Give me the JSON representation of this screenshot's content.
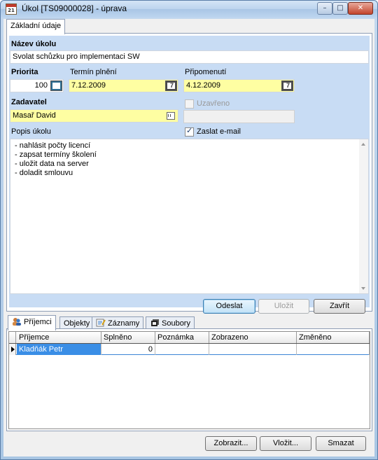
{
  "window": {
    "title": "Úkol [TS09000028] - úprava",
    "icon": "calendar-icon",
    "icon_text": "21"
  },
  "tabs_top": [
    {
      "label": "Základní údaje"
    }
  ],
  "form": {
    "nazev_label": "Název úkolu",
    "nazev_value": "Svolat schůzku pro implementaci SW",
    "priorita_label": "Priorita",
    "priorita_value": "100",
    "termin_label": "Termín plnění",
    "termin_value": "7.12.2009",
    "pripomenuti_label": "Připomenutí",
    "pripomenuti_value": "4.12.2009",
    "zadavatel_label": "Zadavatel",
    "zadavatel_value": "Masař David",
    "uzavreno_label": "Uzavřeno",
    "uzavreno_checked": false,
    "zaslat_label": "Zaslat e-mail",
    "zaslat_checked": true,
    "popis_label": "Popis úkolu",
    "popis_lines": [
      "- nahlásit počty licencí",
      "- zapsat termíny školení",
      "- uložit data na server",
      "- doladit smlouvu"
    ]
  },
  "actions_top": {
    "odeslat": "Odeslat",
    "ulozit": "Uložit",
    "zavrit": "Zavřít"
  },
  "tabs_bottom": [
    {
      "label": "Příjemci",
      "icon": "users-icon"
    },
    {
      "label": "Objekty",
      "icon": ""
    },
    {
      "label": "Záznamy",
      "icon": "notes-icon"
    },
    {
      "label": "Soubory",
      "icon": "files-icon"
    }
  ],
  "grid": {
    "columns": [
      "Příjemce",
      "Splněno",
      "Poznámka",
      "Zobrazeno",
      "Změněno"
    ],
    "rows": [
      [
        "Kladňák Petr",
        "0",
        "",
        "",
        ""
      ]
    ]
  },
  "actions_bottom": {
    "zobrazit": "Zobrazit...",
    "vlozit": "Vložit...",
    "smazat": "Smazat"
  }
}
